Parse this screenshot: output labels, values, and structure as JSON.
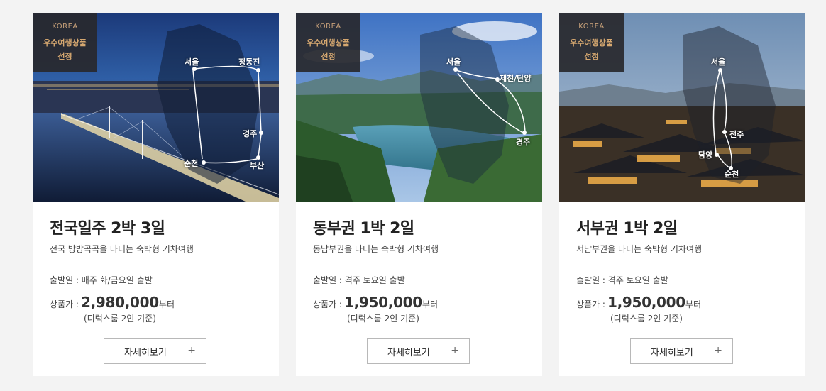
{
  "cards": [
    {
      "badge": {
        "korea": "KOREA",
        "line1": "우수여행상품",
        "line2": "선정"
      },
      "cities": [
        "서울",
        "정동진",
        "경주",
        "부산",
        "순천"
      ],
      "title": "전국일주 2박 3일",
      "subtitle": "전국 방방곡곡을 다니는 숙박형 기차여행",
      "depart": "출발일 : 매주 화/금요일 출발",
      "price_label": "상품가 :",
      "price": "2,980,000",
      "price_unit": "부터",
      "note": "(디럭스룸 2인 기준)",
      "button_label": "자세히보기",
      "button_icon": "+"
    },
    {
      "badge": {
        "korea": "KOREA",
        "line1": "우수여행상품",
        "line2": "선정"
      },
      "cities": [
        "서울",
        "제천/단양",
        "경주"
      ],
      "title": "동부권 1박 2일",
      "subtitle": "동남부권을 다니는 숙박형 기차여행",
      "depart": "출발일 : 격주 토요일 출발",
      "price_label": "상품가 :",
      "price": "1,950,000",
      "price_unit": "부터",
      "note": "(디럭스룸 2인 기준)",
      "button_label": "자세히보기",
      "button_icon": "+"
    },
    {
      "badge": {
        "korea": "KOREA",
        "line1": "우수여행상품",
        "line2": "선정"
      },
      "cities": [
        "서울",
        "전주",
        "담양",
        "순천"
      ],
      "title": "서부권 1박 2일",
      "subtitle": "서남부권을 다니는 숙박형 기차여행",
      "depart": "출발일 : 격주 토요일 출발",
      "price_label": "상품가 :",
      "price": "1,950,000",
      "price_unit": "부터",
      "note": "(디럭스룸 2인 기준)",
      "button_label": "자세히보기",
      "button_icon": "+"
    }
  ]
}
